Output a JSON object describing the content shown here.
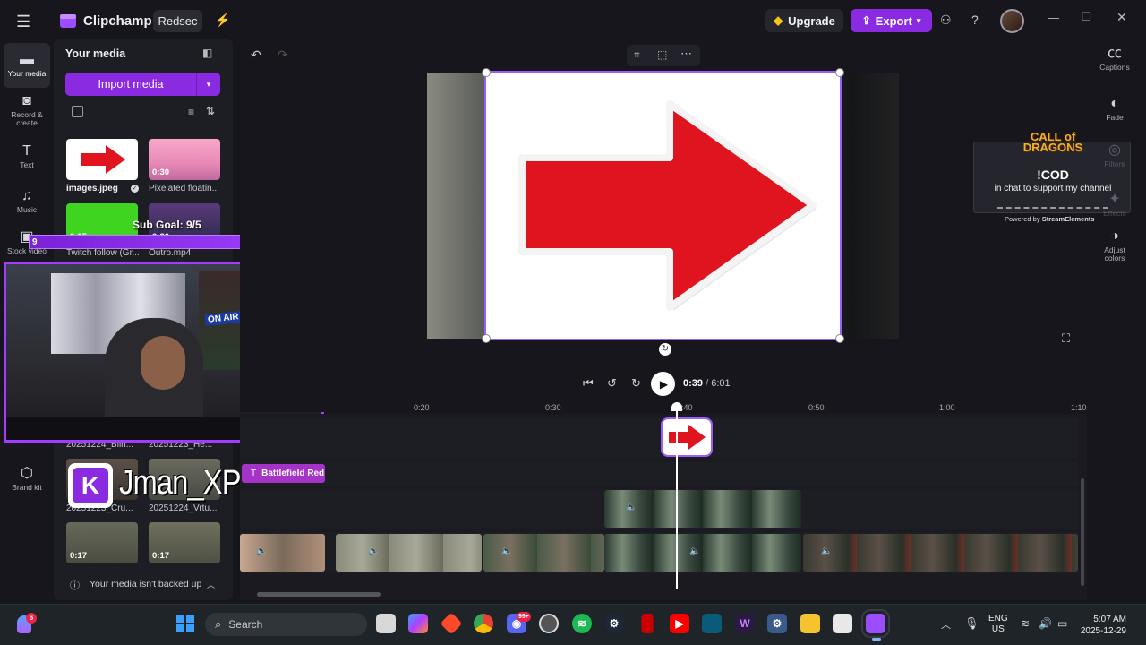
{
  "app": {
    "name": "Clipchamp",
    "project_name": "Redsec"
  },
  "header": {
    "upgrade_label": "Upgrade",
    "export_label": "Export",
    "help_label": "?"
  },
  "rail": {
    "your_media": "Your media",
    "record_create": "Record & create",
    "text": "Text",
    "music": "Music",
    "stock_video": "Stock video",
    "brand_kit": "Brand kit"
  },
  "media": {
    "title": "Your media",
    "import_label": "Import media",
    "items": [
      {
        "name": "images.jpeg",
        "duration": ""
      },
      {
        "name": "Pixelated floatin...",
        "duration": "0:30"
      },
      {
        "name": "Twitch follow (Gr...",
        "duration": "0:05"
      },
      {
        "name": "Outro.mp4",
        "duration": "0:30"
      },
      {
        "name": "20251224_Blin...",
        "duration": ""
      },
      {
        "name": "20251223_He...",
        "duration": ""
      },
      {
        "name": "20251223_Cru...",
        "duration": ""
      },
      {
        "name": "20251224_Vrtu...",
        "duration": ""
      },
      {
        "name": "",
        "duration": "0:17"
      },
      {
        "name": "",
        "duration": "0:17"
      }
    ],
    "backup_notice": "Your media isn't backed up"
  },
  "overlay": {
    "sub_goal": "Sub Goal: 9/5",
    "goal_start": "9",
    "goal_end": "5",
    "on_air": "ON AIR",
    "streamer_name": "Jman_XP",
    "logo_letter": "K"
  },
  "stream_widget": {
    "brand": "CALL of DRAGONS",
    "command": "!COD",
    "subtitle": "in chat to support my channel",
    "powered_by": "Powered by",
    "powered_brand": "StreamElements"
  },
  "right_rail": {
    "captions": "Captions",
    "fade": "Fade",
    "filters": "Filters",
    "effects": "Effects",
    "adjust_colors": "Adjust colors"
  },
  "playback": {
    "current_time": "0:39",
    "separator": "/",
    "total_time": "6:01"
  },
  "timeline": {
    "ruler": [
      "0:20",
      "0:30",
      "0:40",
      "0:50",
      "1:00",
      "1:10"
    ],
    "text_clip_label": "Battlefield Red"
  },
  "taskbar": {
    "search_placeholder": "Search",
    "lang_line1": "ENG",
    "lang_line2": "US",
    "time": "5:07 AM",
    "date": "2025-12-29",
    "notification_count": "6",
    "discord_badge": "99+"
  },
  "colors": {
    "accent": "#8a2be2",
    "arrow_red": "#e0141e",
    "upgrade_gold": "#f5c518"
  }
}
